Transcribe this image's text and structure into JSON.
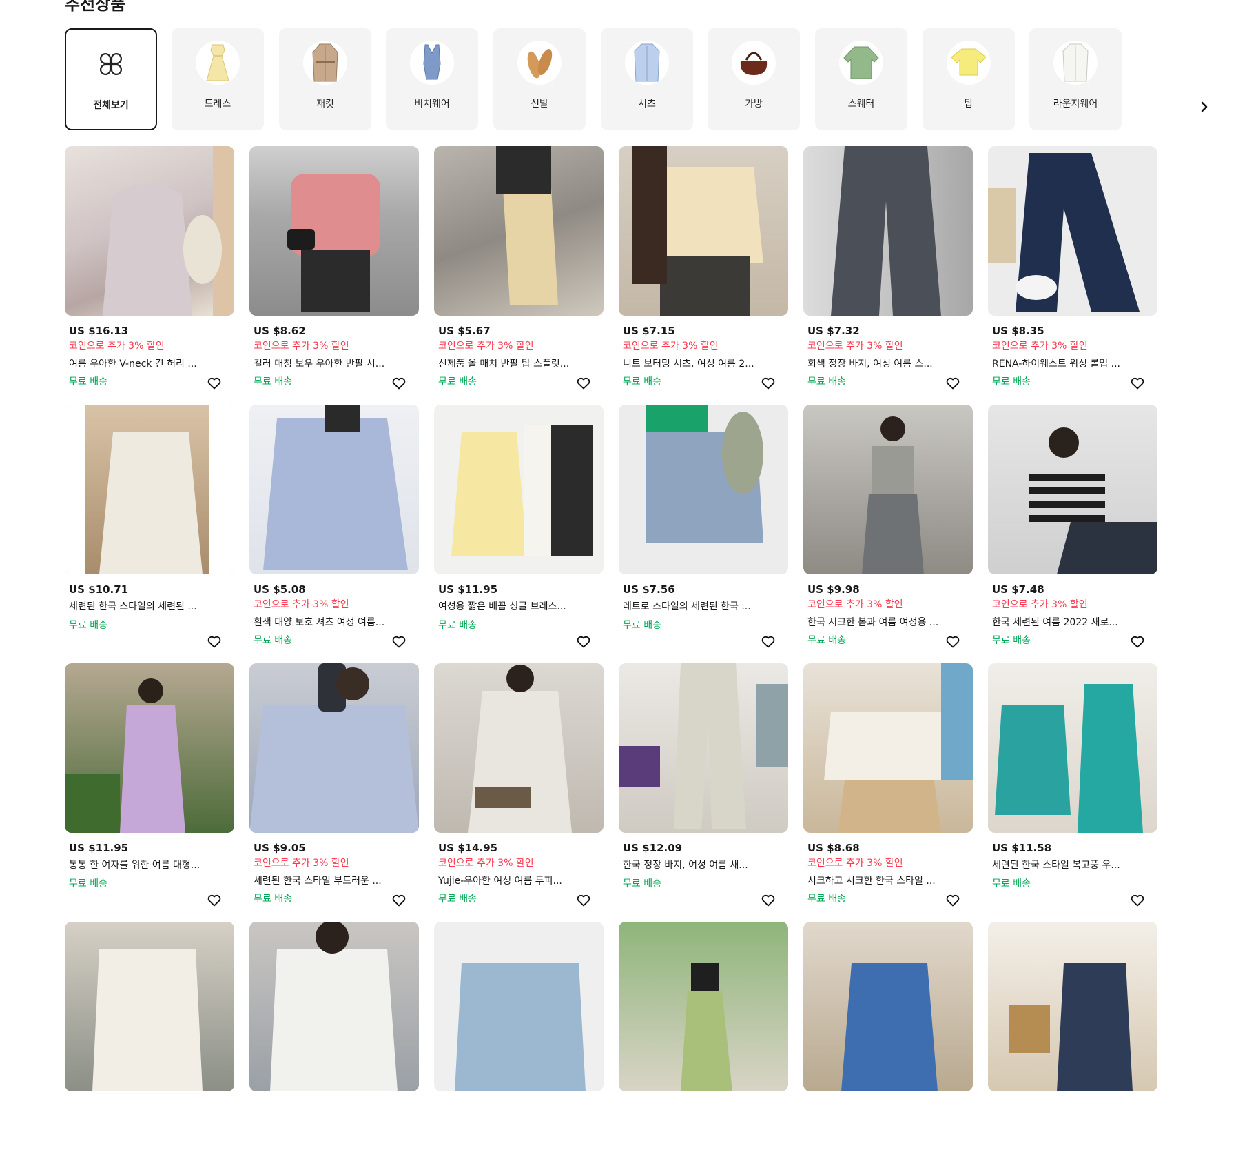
{
  "section": {
    "title": "추천상품"
  },
  "categories": [
    {
      "label": "전체보기",
      "icon": "four-petal-grid-icon",
      "active": true
    },
    {
      "label": "드레스",
      "icon": "dress-icon"
    },
    {
      "label": "재킷",
      "icon": "trench-coat-icon"
    },
    {
      "label": "비치웨어",
      "icon": "swimsuit-icon"
    },
    {
      "label": "신발",
      "icon": "sandals-icon"
    },
    {
      "label": "셔츠",
      "icon": "shirt-icon"
    },
    {
      "label": "가방",
      "icon": "handbag-icon"
    },
    {
      "label": "스웨터",
      "icon": "sweater-icon"
    },
    {
      "label": "탑",
      "icon": "top-icon"
    },
    {
      "label": "라운지웨어",
      "icon": "loungewear-icon"
    }
  ],
  "next_icon": "chevron-right-icon",
  "common": {
    "coin_text": "코인으로 추가 3% 할인",
    "shipping_text": "무료 배송"
  },
  "products": [
    {
      "price": "US $16.13",
      "coin": true,
      "title": "여름 우아한 V-neck 긴 허리 ...",
      "image": "floral-dress-photo"
    },
    {
      "price": "US $8.62",
      "coin": true,
      "title": "컬러 매칭 보우 우아한 반팔 셔...",
      "image": "pink-cardigan-photo"
    },
    {
      "price": "US $5.67",
      "coin": true,
      "title": "신제품 올 매치 반팔 탑 스플릿...",
      "image": "beige-skirt-photo"
    },
    {
      "price": "US $7.15",
      "coin": true,
      "title": "니트 보터밍 셔츠, 여성 여름 2...",
      "image": "knit-cardigan-photo"
    },
    {
      "price": "US $7.32",
      "coin": true,
      "title": "회색 정장 바지, 여성 여름 스...",
      "image": "grey-trousers-photo"
    },
    {
      "price": "US $8.35",
      "coin": true,
      "title": "RENA-하이웨스트 워싱 롤업 ...",
      "image": "denim-jeans-photo"
    },
    {
      "price": "US $10.71",
      "coin": false,
      "title": "세련된 한국 스타일의 세련된 ...",
      "image": "pleated-dress-photo"
    },
    {
      "price": "US $5.08",
      "coin": true,
      "title": "흰색 태양 보호 셔츠 여성 여름...",
      "image": "blue-shirt-photo"
    },
    {
      "price": "US $11.95",
      "coin": false,
      "title": "여성용 짧은 배꼽 싱글 브레스...",
      "image": "yellow-set-photo"
    },
    {
      "price": "US $7.56",
      "coin": false,
      "title": "레트로 스타일의 세련된 한국 ...",
      "image": "denim-shorts-photo"
    },
    {
      "price": "US $9.98",
      "coin": true,
      "title": "한국 시크한 봄과 여름 여성용 ...",
      "image": "grey-wide-pants-photo"
    },
    {
      "price": "US $7.48",
      "coin": true,
      "title": "한국 세련된 여름 2022 새로...",
      "image": "striped-top-photo"
    },
    {
      "price": "US $11.95",
      "coin": false,
      "title": "통통 한 여자를 위한 여름 대형...",
      "image": "lavender-dress-photo"
    },
    {
      "price": "US $9.05",
      "coin": true,
      "title": "세련된 한국 스타일 부드러운 ...",
      "image": "blue-blouse-photo"
    },
    {
      "price": "US $14.95",
      "coin": true,
      "title": "Yujie-우아한 여성 여름 투피...",
      "image": "tweed-two-piece-photo"
    },
    {
      "price": "US $12.09",
      "coin": false,
      "title": "한국 정장 바지, 여성 여름 새...",
      "image": "beige-wide-pants-photo"
    },
    {
      "price": "US $8.68",
      "coin": true,
      "title": "시크하고 시크한 한국 스타일 ...",
      "image": "lace-collar-blouse-photo"
    },
    {
      "price": "US $11.58",
      "coin": false,
      "title": "세련된 한국 스타일 복고풍 우...",
      "image": "teal-dress-photo"
    },
    {
      "price": "",
      "coin": false,
      "title": "",
      "image": "white-lace-set-photo"
    },
    {
      "price": "",
      "coin": false,
      "title": "",
      "image": "white-blazer-photo"
    },
    {
      "price": "",
      "coin": false,
      "title": "",
      "image": "light-denim-shorts-photo"
    },
    {
      "price": "",
      "coin": false,
      "title": "",
      "image": "green-pants-photo"
    },
    {
      "price": "",
      "coin": false,
      "title": "",
      "image": "blue-floral-dress-photo"
    },
    {
      "price": "",
      "coin": false,
      "title": "",
      "image": "navy-set-photo"
    }
  ]
}
